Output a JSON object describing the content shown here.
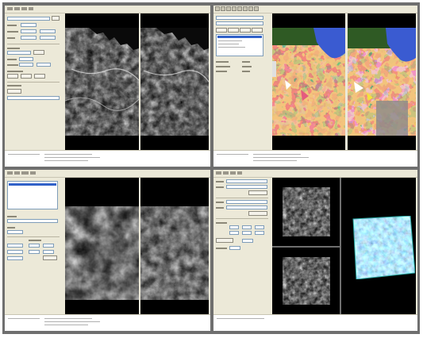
{
  "figure": {
    "title": ""
  },
  "panels": [
    {
      "id": "top-left",
      "caption": "",
      "views": [
        "grayscale-stereo-left",
        "grayscale-stereo-right"
      ]
    },
    {
      "id": "top-right",
      "caption": "",
      "views": [
        "classified-color-left",
        "classified-color-right"
      ]
    },
    {
      "id": "bottom-left",
      "caption": "",
      "views": [
        "hillshade-left",
        "hillshade-right"
      ]
    },
    {
      "id": "bottom-right",
      "caption": "",
      "views": [
        "chip-top",
        "chip-bottom",
        "registered-color"
      ]
    }
  ],
  "colors": {
    "frame": "#6f6f6f",
    "window": "#ece9d8",
    "selection": "#3161c8",
    "water": "#3a5bd1",
    "vegetation": "#2f5a24",
    "field": "#c9873a",
    "bright": "#e45b7e"
  }
}
